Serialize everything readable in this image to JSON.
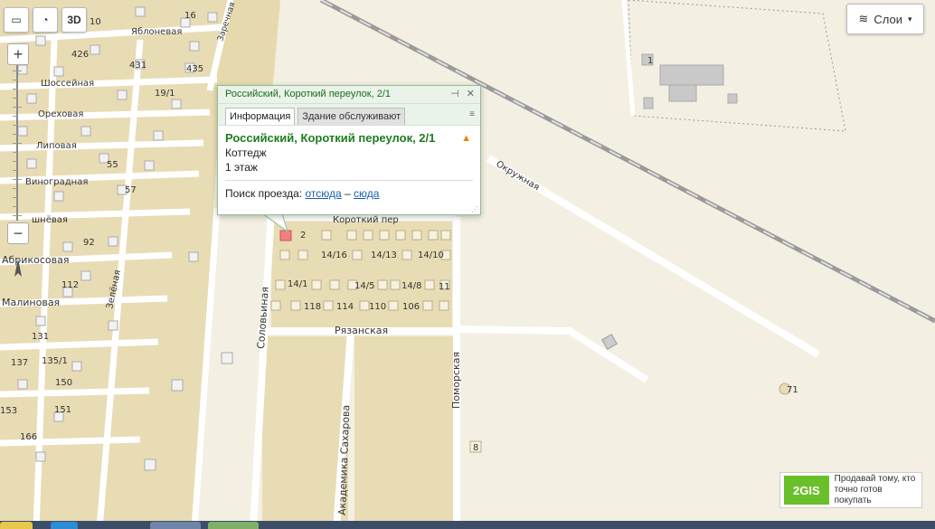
{
  "streets": {
    "yablonevaya": "Яблоневая",
    "shosseynaya": "Шоссейная",
    "orekhovaya": "Ореховая",
    "lipovaya": "Липовая",
    "vinogradnaya": "Виноградная",
    "vishnevaya": "шнёвая",
    "abrikosovaya": "Абрикосовая",
    "malinovaya": "Малиновая",
    "zelenaya": "Зелёная",
    "zarechnaya": "Заречная",
    "solovinaya": "Соловьиная",
    "korotkiy": "Короткий пер",
    "ryazanskaya": "Рязанская",
    "pomorskaya": "Поморская",
    "akademika": "Академика Сахарова",
    "okruzhnaya": "Окружная"
  },
  "house_numbers": {
    "n10": "10",
    "n16": "16",
    "n426": "426",
    "n431": "431",
    "n435": "435",
    "n19_1": "19/1",
    "n55": "55",
    "n57": "57",
    "n92": "92",
    "n112": "112",
    "n131": "131",
    "n137": "137",
    "n135_1": "135/1",
    "n150": "150",
    "n153": "153",
    "n151": "151",
    "n166": "166",
    "n2": "2",
    "n14_16": "14/16",
    "n14_13": "14/13",
    "n14_10": "14/10",
    "n14_1": "14/1",
    "n14_5": "14/5",
    "n14_8": "14/8",
    "n11": "11",
    "n118": "118",
    "n114": "114",
    "n110": "110",
    "n106": "106",
    "n71": "71",
    "n8": "8",
    "n1": "1"
  },
  "toolbar": {
    "three_d": "3D"
  },
  "layers_button": {
    "label": "Слои"
  },
  "popup": {
    "header": "Российский, Короткий переулок, 2/1",
    "tabs": [
      "Информация",
      "Здание обслуживают"
    ],
    "title": "Российский, Короткий переулок, 2/1",
    "type": "Коттедж",
    "floors": "1 этаж",
    "route_label": "Поиск проезда:",
    "route_from": "отсюда",
    "route_dash": "–",
    "route_to": "сюда"
  },
  "ad": {
    "logo": "2GIS",
    "text_line1": "Продавай тому, кто",
    "text_line2": "точно готов покупать"
  },
  "colors": {
    "residential": "#e8dcb5",
    "background": "#f3efe2",
    "popup_green": "#1d7d1d",
    "selected_building": "#f08080"
  }
}
